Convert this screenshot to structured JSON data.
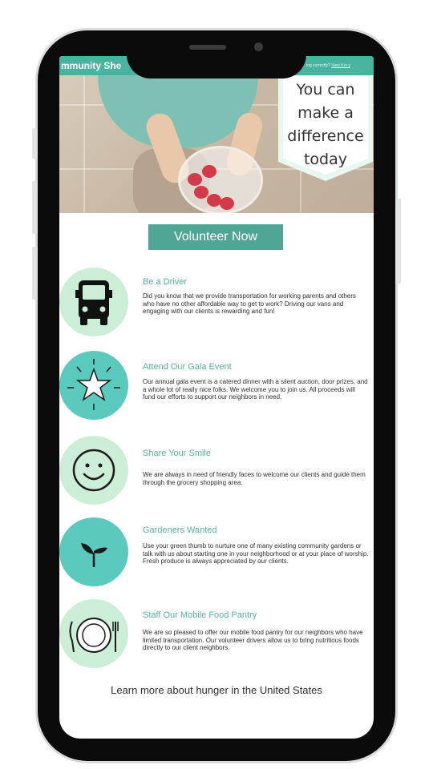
{
  "header": {
    "title": "mmunity She",
    "right_text": "ing correctly?",
    "right_link": "View it in y"
  },
  "banner": {
    "line1": "You can",
    "line2": "make a",
    "line3": "difference",
    "line4": "today"
  },
  "cta": {
    "label": "Volunteer Now"
  },
  "items": [
    {
      "icon": "bus-icon",
      "title": "Be a Driver",
      "text": "Did you know that we provide transportation for working parents and others who have no other affordable way to get to work? Driving our vans and engaging with our clients is rewarding and fun!"
    },
    {
      "icon": "star-icon",
      "title": "Attend Our Gala Event",
      "text": "Our annual gala event is a catered dinner with a silent auction, door prizes, and a whole lot of really nice folks. We welcome you to join us. All proceeds will fund our efforts to support our neighbors in need."
    },
    {
      "icon": "smiley-icon",
      "title": "Share Your Smile",
      "text": "We are always in need of friendly faces to welcome our clients and guide them through the grocery shopping area."
    },
    {
      "icon": "plant-icon",
      "title": "Gardeners Wanted",
      "text": "Use your green thumb to nurture one of many existing community gardens or talk with us about starting one in your neighborhood or at your place of worship. Fresh produce is always appreciated by our clients."
    },
    {
      "icon": "plate-icon",
      "title": "Staff Our Mobile Food Pantry",
      "text": "We are so pleased to offer our mobile food pantry for our neighbors who have limited transportation. Our volunteer drivers allow us to bring nutritious foods directly to our client neighbors."
    }
  ],
  "footer": {
    "learn_more": "Learn more about hunger in the United States"
  },
  "colors": {
    "teal": "#48b39e",
    "dark_teal": "#4fa695",
    "light_green": "#cdeed6",
    "turquoise": "#5cc9bf"
  }
}
